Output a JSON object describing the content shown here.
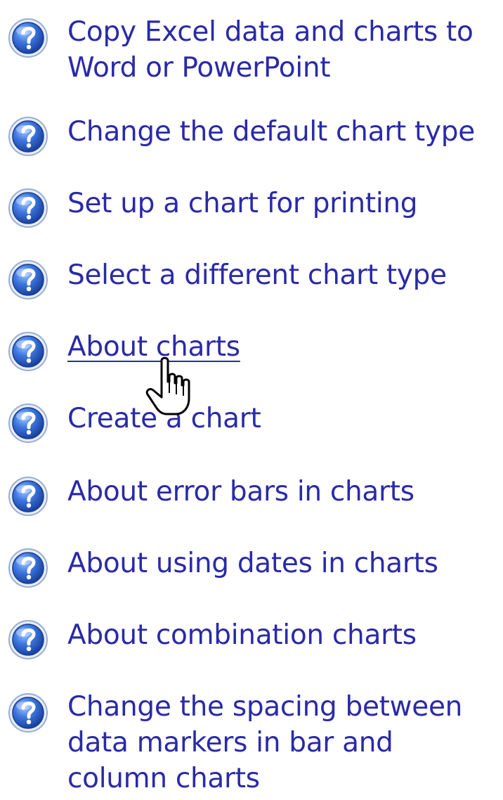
{
  "help_topics": {
    "items": [
      {
        "label": "Copy Excel data and charts to Word or PowerPoint"
      },
      {
        "label": "Change the default chart type"
      },
      {
        "label": "Set up a chart for printing"
      },
      {
        "label": "Select a different chart type"
      },
      {
        "label": "About charts"
      },
      {
        "label": "Create a chart"
      },
      {
        "label": "About error bars in charts"
      },
      {
        "label": "About using dates in charts"
      },
      {
        "label": "About combination charts"
      },
      {
        "label": "Change the spacing between data markers in bar and column charts"
      }
    ],
    "icon": "help-question-icon",
    "hovered_index": 4
  },
  "colors": {
    "link_text": "#2a2aa8",
    "icon_blue": "#1f4fb8",
    "background": "#ffffff"
  },
  "cursor": {
    "icon": "hand-pointer-icon"
  }
}
